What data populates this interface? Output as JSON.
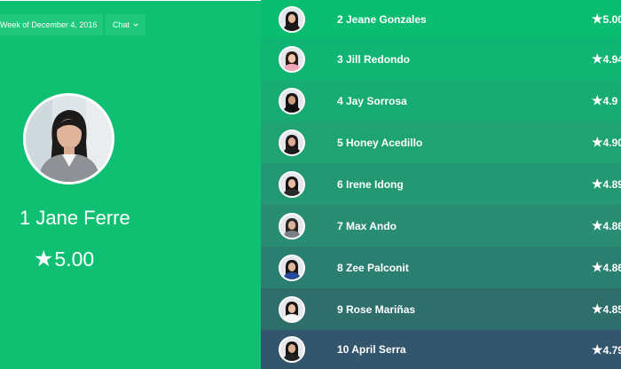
{
  "header": {
    "week_label": "Week of December 4, 2016",
    "chat_label": "Chat"
  },
  "colors": {
    "accent_green": "#0fc073",
    "row_dark": "#2f4e63"
  },
  "leader": {
    "rank_name": "1 Jane Ferre",
    "rating": "5.00",
    "star_icon": "star-icon"
  },
  "rankings": [
    {
      "name": "2 Jeane Gonzales",
      "score": "5.00"
    },
    {
      "name": "3 Jill Redondo",
      "score": "4.94"
    },
    {
      "name": "4 Jay Sorrosa",
      "score": "4.9"
    },
    {
      "name": "5 Honey Acedillo",
      "score": "4.90"
    },
    {
      "name": "6 Irene Idong",
      "score": "4.89"
    },
    {
      "name": "7 Max Ando",
      "score": "4.86"
    },
    {
      "name": "8 Zee Palconit",
      "score": "4.86"
    },
    {
      "name": "9 Rose Mariñas",
      "score": "4.85"
    },
    {
      "name": "10 April Serra",
      "score": "4.79"
    }
  ]
}
